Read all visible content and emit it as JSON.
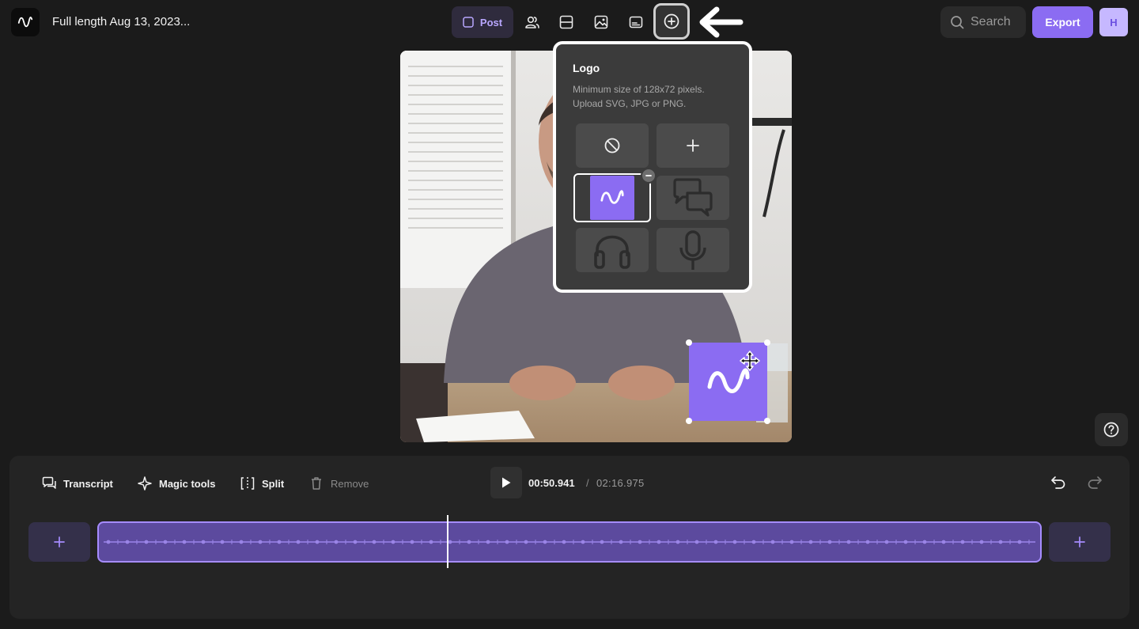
{
  "header": {
    "doc_title": "Full length Aug 13, 2023...",
    "post_label": "Post",
    "search_placeholder": "Search",
    "export_label": "Export",
    "avatar_initial": "H"
  },
  "toolbar_icons": [
    "post-icon",
    "speakers-icon",
    "layout-icon",
    "background-image-icon",
    "captions-icon",
    "add-logo-icon"
  ],
  "logo_popup": {
    "title": "Logo",
    "description": "Minimum size of 128x72 pixels. Upload SVG, JPG or PNG.",
    "options": [
      "none-icon",
      "plus-icon",
      "wave-logo-icon",
      "chat-bubbles-icon",
      "headphones-icon",
      "microphone-icon"
    ],
    "selected": "wave-logo-icon"
  },
  "timeline": {
    "tools": {
      "transcript": "Transcript",
      "magic_tools": "Magic tools",
      "split": "Split",
      "remove": "Remove"
    },
    "current_time": "00:50.941",
    "separator": "/",
    "total_time": "02:16.975"
  },
  "colors": {
    "accent": "#8b6cf2",
    "background": "#1b1b1b",
    "panel": "#242424",
    "clip": "#5c4a9e"
  }
}
